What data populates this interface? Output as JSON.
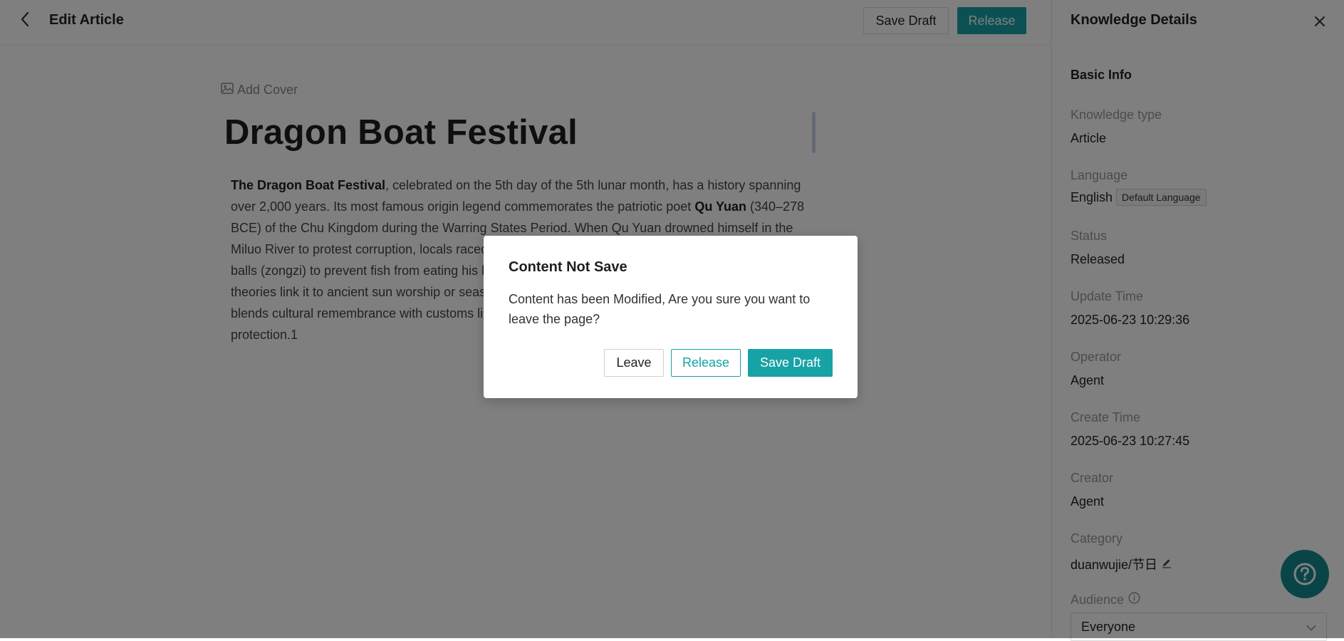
{
  "header": {
    "title": "Edit Article",
    "save_draft_label": "Save Draft",
    "release_label": "Release"
  },
  "editor": {
    "add_cover_label": "Add Cover",
    "title": "Dragon Boat Festival",
    "body": {
      "p1_bold": "The Dragon Boat Festival",
      "p1_text1": ", celebrated on the 5th day of the 5th lunar month, has a history spanning over 2,000 years. Its most famous origin legend commemorates the patriotic poet ",
      "p1_bold2": "Qu Yuan",
      "p1_text2": " (340–278 BCE) of the Chu Kingdom during the Warring States Period. When Qu Yuan drowned himself in the Miluo River to protest corruption, locals raced boats",
      "p1_line5": "balls (zongzi) to prevent fish from eating his b",
      "p1_line6": "theories link it to ancient sun worship or seaso",
      "p1_line7": "blends cultural remembrance with customs lik",
      "p1_line8": "protection.1"
    }
  },
  "panel": {
    "title": "Knowledge Details",
    "section": "Basic Info",
    "fields": {
      "knowledge_type": {
        "label": "Knowledge type",
        "value": "Article"
      },
      "language": {
        "label": "Language",
        "value": "English",
        "badge": "Default Language"
      },
      "status": {
        "label": "Status",
        "value": "Released"
      },
      "update_time": {
        "label": "Update Time",
        "value": "2025-06-23 10:29:36"
      },
      "operator": {
        "label": "Operator",
        "value": "Agent"
      },
      "create_time": {
        "label": "Create Time",
        "value": "2025-06-23 10:27:45"
      },
      "creator": {
        "label": "Creator",
        "value": "Agent"
      },
      "category": {
        "label": "Category",
        "value": "duanwujie/节日"
      },
      "audience": {
        "label": "Audience",
        "value": "Everyone"
      }
    }
  },
  "modal": {
    "title": "Content Not Save",
    "message": "Content has been Modified, Are you sure you want to leave the page?",
    "leave_label": "Leave",
    "release_label": "Release",
    "save_draft_label": "Save Draft"
  },
  "colors": {
    "accent": "#17a2a6",
    "help_fab": "#138b8f",
    "overlay": "rgba(0,0,0,0.5)"
  },
  "icons": [
    "back-arrow-icon",
    "image-icon",
    "close-icon",
    "info-icon",
    "edit-pencil-icon",
    "chevron-down-icon",
    "help-question-icon"
  ]
}
